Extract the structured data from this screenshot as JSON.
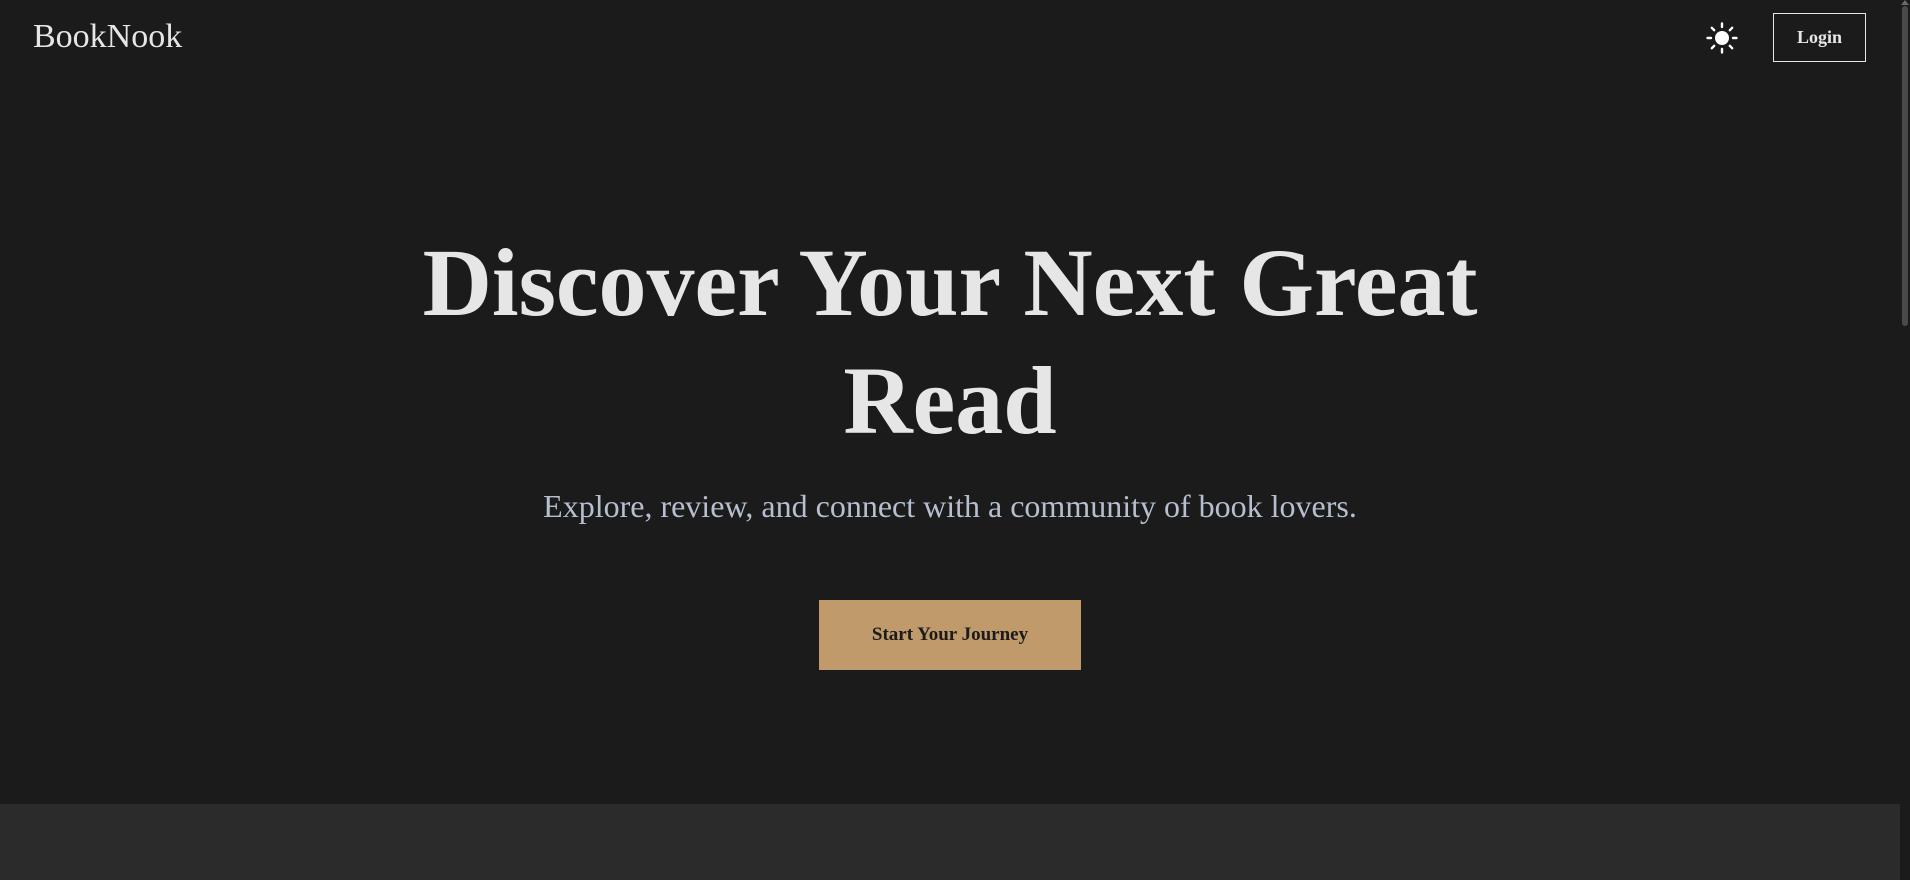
{
  "app": {
    "logo_text": "BookNook"
  },
  "header": {
    "theme_icon": "sun-icon",
    "login_label": "Login"
  },
  "hero": {
    "title_line1": "Discover Your Next Great",
    "title_line2": "Read",
    "subtitle": "Explore, review, and connect with a community of book lovers.",
    "cta_label": "Start Your Journey"
  },
  "colors": {
    "background": "#1b1b1b",
    "accent": "#c19a6b",
    "text": "#e6e6e6",
    "subtitle_text": "#b6bfcf",
    "next_section": "#2b2b2b"
  }
}
